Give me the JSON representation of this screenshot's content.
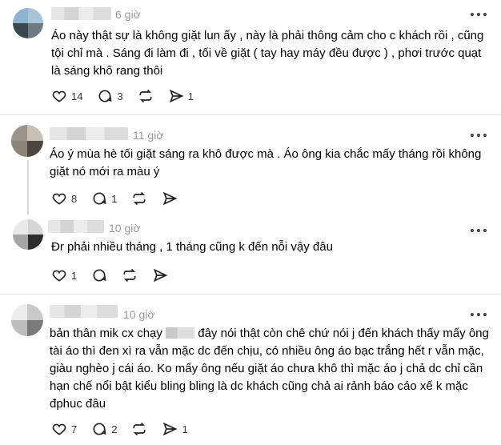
{
  "posts": [
    {
      "time": "6 giờ",
      "text": "Áo này thật sự là không giặt lun ấy , này là phải thông cảm cho c khách rồi , cũng\ntội chỉ mà . Sáng đi làm đi , tối về giặt ( tay hay máy đều được ) , phơi trước quạt\nlà sáng khô rang thôi",
      "likes": "14",
      "replies": "3",
      "reposts": "",
      "shares": "1",
      "avatar_colors": [
        "#8db3cf",
        "#a9c4d6",
        "#3c4650",
        "#6f7a82"
      ]
    },
    {
      "time": "11 giờ",
      "text": "Áo ý mùa hè tối giặt sáng ra khô được mà . Áo ông kia chắc mấy tháng rồi không\ngiặt nó mới ra màu ý",
      "likes": "8",
      "replies": "1",
      "reposts": "",
      "shares": "",
      "avatar_colors": [
        "#9b948c",
        "#c9bfb5",
        "#8d8479",
        "#4b463f"
      ]
    },
    {
      "time": "10 giờ",
      "text": "Đr phải nhiều tháng , 1 tháng cũng k đến nỗi vậy đâu",
      "likes": "1",
      "replies": "",
      "reposts": "",
      "shares": "",
      "avatar_colors": [
        "#e9e9e9",
        "#d6d6d6",
        "#a5a5a5",
        "#2d2d2d"
      ]
    },
    {
      "time": "10 giờ",
      "text_before_censor": "bản thân mik cx chạy ",
      "text_after_censor": " đây nói thật còn chê chứ nói j đến khách thấy mấy ông\ntài áo thì đen xì ra vẫn mặc dc đến chịu, có nhiều ông áo bạc trắng hết r vẫn mặc,\ngiàu nghèo j cái áo. Ko mấy ông nếu giặt áo chưa khô thì mặc áo j chả dc chỉ cần\nhạn chế nổi bật kiểu bling bling là dc khách cũng chả ai rảnh báo cáo xế k mặc\nđphuc đâu",
      "likes": "7",
      "replies": "2",
      "reposts": "",
      "shares": "1",
      "avatar_colors": [
        "#ececec",
        "#c9c9c9",
        "#bdbdbd",
        "#7a7a7a"
      ]
    }
  ]
}
